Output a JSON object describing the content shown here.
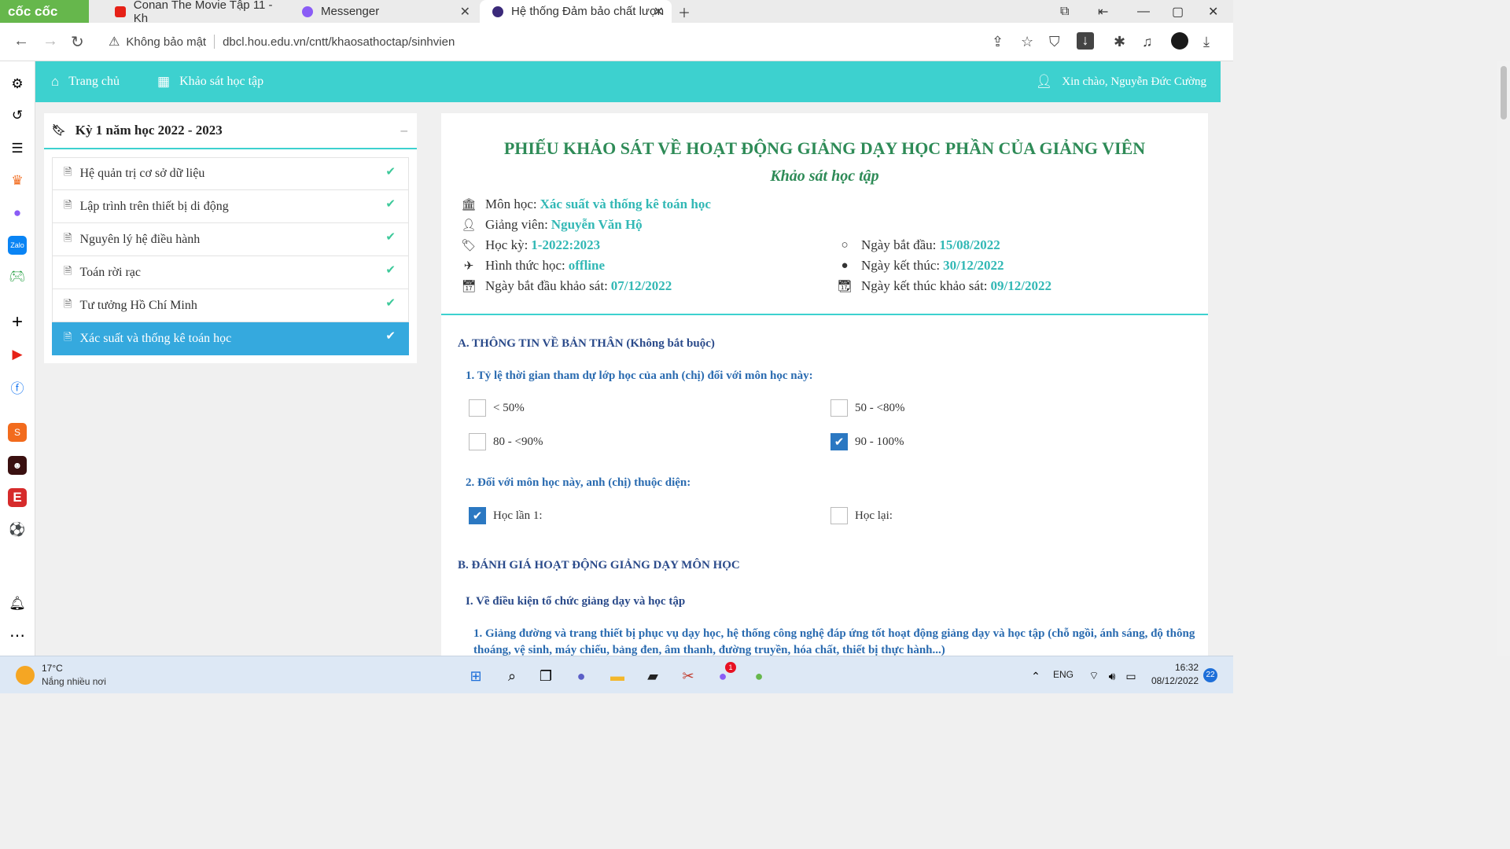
{
  "browser": {
    "logo": "cốc cốc",
    "tabs": [
      {
        "title": "Conan The Movie Tập 11 - Kh",
        "icon": "youtube-icon",
        "color": "#e62117"
      },
      {
        "title": "Messenger",
        "icon": "messenger-icon",
        "color": "#8a5cf6"
      },
      {
        "title": "Hệ thống Đảm bảo chất lượn",
        "icon": "hou-icon",
        "color": "#3b2a7a"
      }
    ],
    "security_label": "Không bảo mật",
    "url": "dbcl.hou.edu.vn/cntt/khaosathoctap/sinhvien"
  },
  "topnav": {
    "home": "Trang chủ",
    "survey": "Khảo sát học tập",
    "greeting": "Xin chào, Nguyễn Đức Cường"
  },
  "semester_panel": {
    "title": "Kỳ 1 năm học 2022 - 2023",
    "courses": [
      {
        "name": "Hệ quản trị cơ sở dữ liệu"
      },
      {
        "name": "Lập trình trên thiết bị di động"
      },
      {
        "name": "Nguyên lý hệ điều hành"
      },
      {
        "name": "Toán rời rạc"
      },
      {
        "name": "Tư tưởng Hồ Chí Minh"
      },
      {
        "name": "Xác suất và thống kê toán học"
      }
    ]
  },
  "form": {
    "title": "PHIẾU KHẢO SÁT VỀ HOẠT ĐỘNG GIẢNG DẠY HỌC PHẦN CỦA GIẢNG VIÊN",
    "subtitle": "Khảo sát học tập",
    "info": {
      "subject_label": "Môn học:",
      "subject": "Xác suất và thống kê toán học",
      "lecturer_label": "Giảng viên:",
      "lecturer": "Nguyễn Văn Hộ",
      "term_label": "Học kỳ:",
      "term": "1-2022:2023",
      "mode_label": "Hình thức học:",
      "mode": "offline",
      "survey_start_label": "Ngày bắt đầu khảo sát:",
      "survey_start": "07/12/2022",
      "start_label": "Ngày bắt đầu:",
      "start": "15/08/2022",
      "end_label": "Ngày kết thúc:",
      "end": "30/12/2022",
      "survey_end_label": "Ngày kết thúc khảo sát:",
      "survey_end": "09/12/2022"
    },
    "section_a": "A. THÔNG TIN VỀ BẢN THÂN (Không bắt buộc)",
    "q1": "1. Tỷ lệ thời gian tham dự lớp học của anh (chị) đối với môn học này:",
    "q1_options": [
      {
        "label": "< 50%",
        "checked": false
      },
      {
        "label": "50 - <80%",
        "checked": false
      },
      {
        "label": "80 - <90%",
        "checked": false
      },
      {
        "label": "90 - 100%",
        "checked": true
      }
    ],
    "q2": "2. Đối với môn học này, anh (chị) thuộc diện:",
    "q2_options": [
      {
        "label": "Học lần 1:",
        "checked": true
      },
      {
        "label": "Học lại:",
        "checked": false
      }
    ],
    "section_b": "B. ĐÁNH GIÁ HOẠT ĐỘNG GIẢNG DẠY MÔN HỌC",
    "b_part1": "I. Về điều kiện tổ chức giảng dạy và học tập",
    "b_q1": "1. Giảng đường và trang thiết bị phục vụ dạy học, hệ thống công nghệ đáp ứng tốt hoạt động giảng dạy và học tập (chỗ ngồi, ánh sáng, độ thông thoáng, vệ sinh, máy chiếu, bảng đen, âm thanh, đường truyền, hóa chất, thiết bị thực hành...)"
  },
  "taskbar": {
    "weather_temp": "17°C",
    "weather_text": "Nắng nhiều nơi",
    "lang": "ENG",
    "time": "16:32",
    "date": "08/12/2022",
    "notif_count": "22",
    "messenger_badge": "1"
  }
}
